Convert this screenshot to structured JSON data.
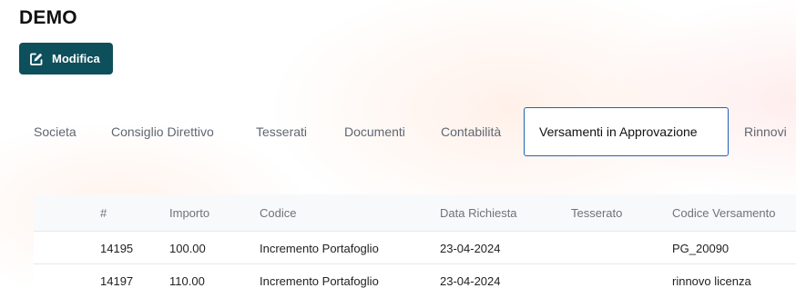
{
  "page": {
    "title": "DEMO"
  },
  "toolbar": {
    "edit_label": "Modifica",
    "edit_icon": "edit-square-icon",
    "accent_color": "#0e4f5c"
  },
  "tabs": [
    {
      "label": "Societa",
      "active": false
    },
    {
      "label": "Consiglio Direttivo",
      "active": false
    },
    {
      "label": "Tesserati",
      "active": false
    },
    {
      "label": "Documenti",
      "active": false
    },
    {
      "label": "Contabilità",
      "active": false
    },
    {
      "label": "Versamenti in Approvazione",
      "active": true
    },
    {
      "label": "Rinnovi",
      "active": false
    }
  ],
  "table": {
    "columns": [
      "#",
      "Importo",
      "Codice",
      "Data Richiesta",
      "Tesserato",
      "Codice Versamento"
    ],
    "rows": [
      [
        "14195",
        "100.00",
        "Incremento Portafoglio",
        "23-04-2024",
        "",
        "PG_20090"
      ],
      [
        "14197",
        "110.00",
        "Incremento Portafoglio",
        "23-04-2024",
        "",
        "rinnovo licenza"
      ]
    ]
  }
}
